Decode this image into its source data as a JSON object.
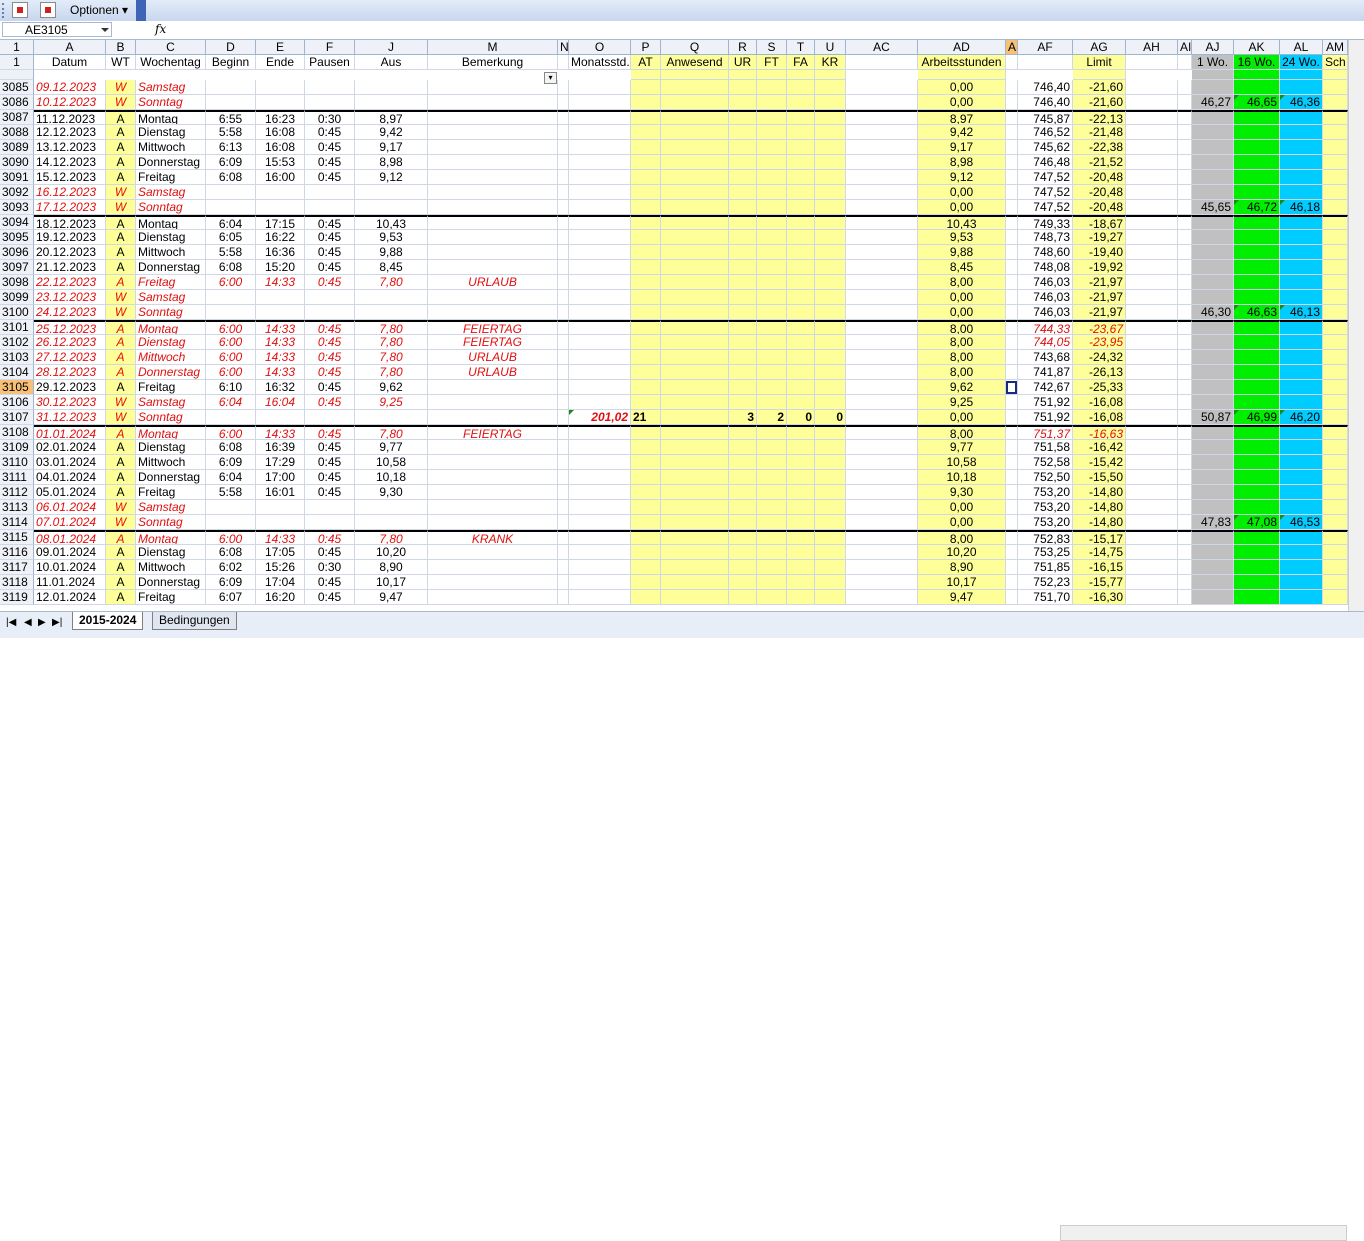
{
  "toolbar": {
    "options_label": "Optionen"
  },
  "formula_bar": {
    "name_box": "AE3105",
    "fx": "fx"
  },
  "columns": [
    {
      "id": "rh",
      "letter": "1",
      "header": ""
    },
    {
      "id": "A",
      "letter": "A",
      "header": "Datum"
    },
    {
      "id": "B",
      "letter": "B",
      "header": "WT"
    },
    {
      "id": "C",
      "letter": "C",
      "header": "Wochentag"
    },
    {
      "id": "D",
      "letter": "D",
      "header": "Beginn"
    },
    {
      "id": "E",
      "letter": "E",
      "header": "Ende"
    },
    {
      "id": "F",
      "letter": "F",
      "header": "Pausen"
    },
    {
      "id": "J",
      "letter": "J",
      "header": "Aus"
    },
    {
      "id": "M",
      "letter": "M",
      "header": "Bemerkung"
    },
    {
      "id": "N",
      "letter": "N",
      "header": ""
    },
    {
      "id": "O",
      "letter": "O",
      "header": "Monatsstd."
    },
    {
      "id": "P",
      "letter": "P",
      "header": "AT"
    },
    {
      "id": "Q",
      "letter": "Q",
      "header": "Anwesend"
    },
    {
      "id": "R",
      "letter": "R",
      "header": "UR"
    },
    {
      "id": "S",
      "letter": "S",
      "header": "FT"
    },
    {
      "id": "T",
      "letter": "T",
      "header": "FA"
    },
    {
      "id": "U",
      "letter": "U",
      "header": "KR"
    },
    {
      "id": "AC",
      "letter": "AC",
      "header": ""
    },
    {
      "id": "AD",
      "letter": "AD",
      "header": "Arbeitsstunden"
    },
    {
      "id": "AE",
      "letter": "AE",
      "header": ""
    },
    {
      "id": "AF",
      "letter": "AF",
      "header": ""
    },
    {
      "id": "AG",
      "letter": "AG",
      "header": "Limit"
    },
    {
      "id": "AH",
      "letter": "AH",
      "header": ""
    },
    {
      "id": "AI",
      "letter": "AI",
      "header": ""
    },
    {
      "id": "AJ",
      "letter": "AJ",
      "header": "1 Wo."
    },
    {
      "id": "AK",
      "letter": "AK",
      "header": "16 Wo."
    },
    {
      "id": "AL",
      "letter": "AL",
      "header": "24 Wo."
    },
    {
      "id": "AM",
      "letter": "AM",
      "header": "Sch"
    }
  ],
  "rows": [
    {
      "n": "3085",
      "date": "09.12.2023",
      "wt": "W",
      "day": "Samstag",
      "red": true,
      "b": "",
      "e": "",
      "p": "",
      "aus": "",
      "rem": "",
      "ad": "0,00",
      "af": "746,40",
      "ag": "-21,60"
    },
    {
      "n": "3086",
      "date": "10.12.2023",
      "wt": "W",
      "day": "Sonntag",
      "red": true,
      "b": "",
      "e": "",
      "p": "",
      "aus": "",
      "rem": "",
      "ad": "0,00",
      "af": "746,40",
      "ag": "-21,60",
      "aj": "46,27",
      "ak": "46,65",
      "al": "46,36"
    },
    {
      "n": "3087",
      "date": "11.12.2023",
      "wt": "A",
      "day": "Montag",
      "b": "6:55",
      "e": "16:23",
      "p": "0:30",
      "aus": "8,97",
      "rem": "",
      "ad": "8,97",
      "af": "745,87",
      "ag": "-22,13",
      "top": true
    },
    {
      "n": "3088",
      "date": "12.12.2023",
      "wt": "A",
      "day": "Dienstag",
      "b": "5:58",
      "e": "16:08",
      "p": "0:45",
      "aus": "9,42",
      "rem": "",
      "ad": "9,42",
      "af": "746,52",
      "ag": "-21,48"
    },
    {
      "n": "3089",
      "date": "13.12.2023",
      "wt": "A",
      "day": "Mittwoch",
      "b": "6:13",
      "e": "16:08",
      "p": "0:45",
      "aus": "9,17",
      "rem": "",
      "ad": "9,17",
      "af": "745,62",
      "ag": "-22,38"
    },
    {
      "n": "3090",
      "date": "14.12.2023",
      "wt": "A",
      "day": "Donnerstag",
      "b": "6:09",
      "e": "15:53",
      "p": "0:45",
      "aus": "8,98",
      "rem": "",
      "ad": "8,98",
      "af": "746,48",
      "ag": "-21,52"
    },
    {
      "n": "3091",
      "date": "15.12.2023",
      "wt": "A",
      "day": "Freitag",
      "b": "6:08",
      "e": "16:00",
      "p": "0:45",
      "aus": "9,12",
      "rem": "",
      "ad": "9,12",
      "af": "747,52",
      "ag": "-20,48"
    },
    {
      "n": "3092",
      "date": "16.12.2023",
      "wt": "W",
      "day": "Samstag",
      "red": true,
      "b": "",
      "e": "",
      "p": "",
      "aus": "",
      "rem": "",
      "ad": "0,00",
      "af": "747,52",
      "ag": "-20,48"
    },
    {
      "n": "3093",
      "date": "17.12.2023",
      "wt": "W",
      "day": "Sonntag",
      "red": true,
      "b": "",
      "e": "",
      "p": "",
      "aus": "",
      "rem": "",
      "ad": "0,00",
      "af": "747,52",
      "ag": "-20,48",
      "aj": "45,65",
      "ak": "46,72",
      "al": "46,18"
    },
    {
      "n": "3094",
      "date": "18.12.2023",
      "wt": "A",
      "day": "Montag",
      "b": "6:04",
      "e": "17:15",
      "p": "0:45",
      "aus": "10,43",
      "rem": "",
      "ad": "10,43",
      "af": "749,33",
      "ag": "-18,67",
      "top": true
    },
    {
      "n": "3095",
      "date": "19.12.2023",
      "wt": "A",
      "day": "Dienstag",
      "b": "6:05",
      "e": "16:22",
      "p": "0:45",
      "aus": "9,53",
      "rem": "",
      "ad": "9,53",
      "af": "748,73",
      "ag": "-19,27"
    },
    {
      "n": "3096",
      "date": "20.12.2023",
      "wt": "A",
      "day": "Mittwoch",
      "b": "5:58",
      "e": "16:36",
      "p": "0:45",
      "aus": "9,88",
      "rem": "",
      "ad": "9,88",
      "af": "748,60",
      "ag": "-19,40"
    },
    {
      "n": "3097",
      "date": "21.12.2023",
      "wt": "A",
      "day": "Donnerstag",
      "b": "6:08",
      "e": "15:20",
      "p": "0:45",
      "aus": "8,45",
      "rem": "",
      "ad": "8,45",
      "af": "748,08",
      "ag": "-19,92"
    },
    {
      "n": "3098",
      "date": "22.12.2023",
      "wt": "A",
      "day": "Freitag",
      "red": true,
      "b": "6:00",
      "e": "14:33",
      "p": "0:45",
      "aus": "7,80",
      "rem": "URLAUB",
      "ad": "8,00",
      "af": "746,03",
      "ag": "-21,97"
    },
    {
      "n": "3099",
      "date": "23.12.2023",
      "wt": "W",
      "day": "Samstag",
      "red": true,
      "b": "",
      "e": "",
      "p": "",
      "aus": "",
      "rem": "",
      "ad": "0,00",
      "af": "746,03",
      "ag": "-21,97"
    },
    {
      "n": "3100",
      "date": "24.12.2023",
      "wt": "W",
      "day": "Sonntag",
      "red": true,
      "b": "",
      "e": "",
      "p": "",
      "aus": "",
      "rem": "",
      "ad": "0,00",
      "af": "746,03",
      "ag": "-21,97",
      "aj": "46,30",
      "ak": "46,63",
      "al": "46,13"
    },
    {
      "n": "3101",
      "date": "25.12.2023",
      "wt": "A",
      "day": "Montag",
      "red": true,
      "b": "6:00",
      "e": "14:33",
      "p": "0:45",
      "aus": "7,80",
      "rem": "FEIERTAG",
      "ad": "8,00",
      "af": "744,33",
      "ag": "-23,67",
      "afred": true,
      "top": true
    },
    {
      "n": "3102",
      "date": "26.12.2023",
      "wt": "A",
      "day": "Dienstag",
      "red": true,
      "b": "6:00",
      "e": "14:33",
      "p": "0:45",
      "aus": "7,80",
      "rem": "FEIERTAG",
      "ad": "8,00",
      "af": "744,05",
      "ag": "-23,95",
      "afred": true
    },
    {
      "n": "3103",
      "date": "27.12.2023",
      "wt": "A",
      "day": "Mittwoch",
      "red": true,
      "b": "6:00",
      "e": "14:33",
      "p": "0:45",
      "aus": "7,80",
      "rem": "URLAUB",
      "ad": "8,00",
      "af": "743,68",
      "ag": "-24,32"
    },
    {
      "n": "3104",
      "date": "28.12.2023",
      "wt": "A",
      "day": "Donnerstag",
      "red": true,
      "b": "6:00",
      "e": "14:33",
      "p": "0:45",
      "aus": "7,80",
      "rem": "URLAUB",
      "ad": "8,00",
      "af": "741,87",
      "ag": "-26,13"
    },
    {
      "n": "3105",
      "date": "29.12.2023",
      "wt": "A",
      "day": "Freitag",
      "b": "6:10",
      "e": "16:32",
      "p": "0:45",
      "aus": "9,62",
      "rem": "",
      "ad": "9,62",
      "af": "742,67",
      "ag": "-25,33",
      "selected": true
    },
    {
      "n": "3106",
      "date": "30.12.2023",
      "wt": "W",
      "day": "Samstag",
      "red": true,
      "b": "6:04",
      "e": "16:04",
      "p": "0:45",
      "aus": "9,25",
      "rem": "",
      "ad": "9,25",
      "af": "751,92",
      "ag": "-16,08"
    },
    {
      "n": "3107",
      "date": "31.12.2023",
      "wt": "W",
      "day": "Sonntag",
      "red": true,
      "b": "",
      "e": "",
      "p": "",
      "aus": "",
      "rem": "",
      "ad": "0,00",
      "af": "751,92",
      "ag": "-16,08",
      "aj": "50,87",
      "ak": "46,99",
      "al": "46,20",
      "o": "201,02",
      "pat": "21",
      "r": "3",
      "s": "2",
      "t": "0",
      "u": "0"
    },
    {
      "n": "3108",
      "date": "01.01.2024",
      "wt": "A",
      "day": "Montag",
      "red": true,
      "b": "6:00",
      "e": "14:33",
      "p": "0:45",
      "aus": "7,80",
      "rem": "FEIERTAG",
      "ad": "8,00",
      "af": "751,37",
      "ag": "-16,63",
      "afred": true,
      "top": true
    },
    {
      "n": "3109",
      "date": "02.01.2024",
      "wt": "A",
      "day": "Dienstag",
      "b": "6:08",
      "e": "16:39",
      "p": "0:45",
      "aus": "9,77",
      "rem": "",
      "ad": "9,77",
      "af": "751,58",
      "ag": "-16,42"
    },
    {
      "n": "3110",
      "date": "03.01.2024",
      "wt": "A",
      "day": "Mittwoch",
      "b": "6:09",
      "e": "17:29",
      "p": "0:45",
      "aus": "10,58",
      "rem": "",
      "ad": "10,58",
      "af": "752,58",
      "ag": "-15,42"
    },
    {
      "n": "3111",
      "date": "04.01.2024",
      "wt": "A",
      "day": "Donnerstag",
      "b": "6:04",
      "e": "17:00",
      "p": "0:45",
      "aus": "10,18",
      "rem": "",
      "ad": "10,18",
      "af": "752,50",
      "ag": "-15,50"
    },
    {
      "n": "3112",
      "date": "05.01.2024",
      "wt": "A",
      "day": "Freitag",
      "b": "5:58",
      "e": "16:01",
      "p": "0:45",
      "aus": "9,30",
      "rem": "",
      "ad": "9,30",
      "af": "753,20",
      "ag": "-14,80"
    },
    {
      "n": "3113",
      "date": "06.01.2024",
      "wt": "W",
      "day": "Samstag",
      "red": true,
      "b": "",
      "e": "",
      "p": "",
      "aus": "",
      "rem": "",
      "ad": "0,00",
      "af": "753,20",
      "ag": "-14,80"
    },
    {
      "n": "3114",
      "date": "07.01.2024",
      "wt": "W",
      "day": "Sonntag",
      "red": true,
      "b": "",
      "e": "",
      "p": "",
      "aus": "",
      "rem": "",
      "ad": "0,00",
      "af": "753,20",
      "ag": "-14,80",
      "aj": "47,83",
      "ak": "47,08",
      "al": "46,53"
    },
    {
      "n": "3115",
      "date": "08.01.2024",
      "wt": "A",
      "day": "Montag",
      "red": true,
      "b": "6:00",
      "e": "14:33",
      "p": "0:45",
      "aus": "7,80",
      "rem": "KRANK",
      "ad": "8,00",
      "af": "752,83",
      "ag": "-15,17",
      "top": true
    },
    {
      "n": "3116",
      "date": "09.01.2024",
      "wt": "A",
      "day": "Dienstag",
      "b": "6:08",
      "e": "17:05",
      "p": "0:45",
      "aus": "10,20",
      "rem": "",
      "ad": "10,20",
      "af": "753,25",
      "ag": "-14,75"
    },
    {
      "n": "3117",
      "date": "10.01.2024",
      "wt": "A",
      "day": "Mittwoch",
      "b": "6:02",
      "e": "15:26",
      "p": "0:30",
      "aus": "8,90",
      "rem": "",
      "ad": "8,90",
      "af": "751,85",
      "ag": "-16,15"
    },
    {
      "n": "3118",
      "date": "11.01.2024",
      "wt": "A",
      "day": "Donnerstag",
      "b": "6:09",
      "e": "17:04",
      "p": "0:45",
      "aus": "10,17",
      "rem": "",
      "ad": "10,17",
      "af": "752,23",
      "ag": "-15,77"
    },
    {
      "n": "3119",
      "date": "12.01.2024",
      "wt": "A",
      "day": "Freitag",
      "b": "6:07",
      "e": "16:20",
      "p": "0:45",
      "aus": "9,47",
      "rem": "",
      "ad": "9,47",
      "af": "751,70",
      "ag": "-16,30"
    }
  ],
  "sheet_tabs": [
    "2015-2024",
    "Bedingungen"
  ],
  "colors": {
    "yellow": "#ffff99",
    "grey": "#c0c0c0",
    "green": "#00ee00",
    "cyan": "#00ccff",
    "red": "#e01010",
    "selected": "#f8c076"
  }
}
